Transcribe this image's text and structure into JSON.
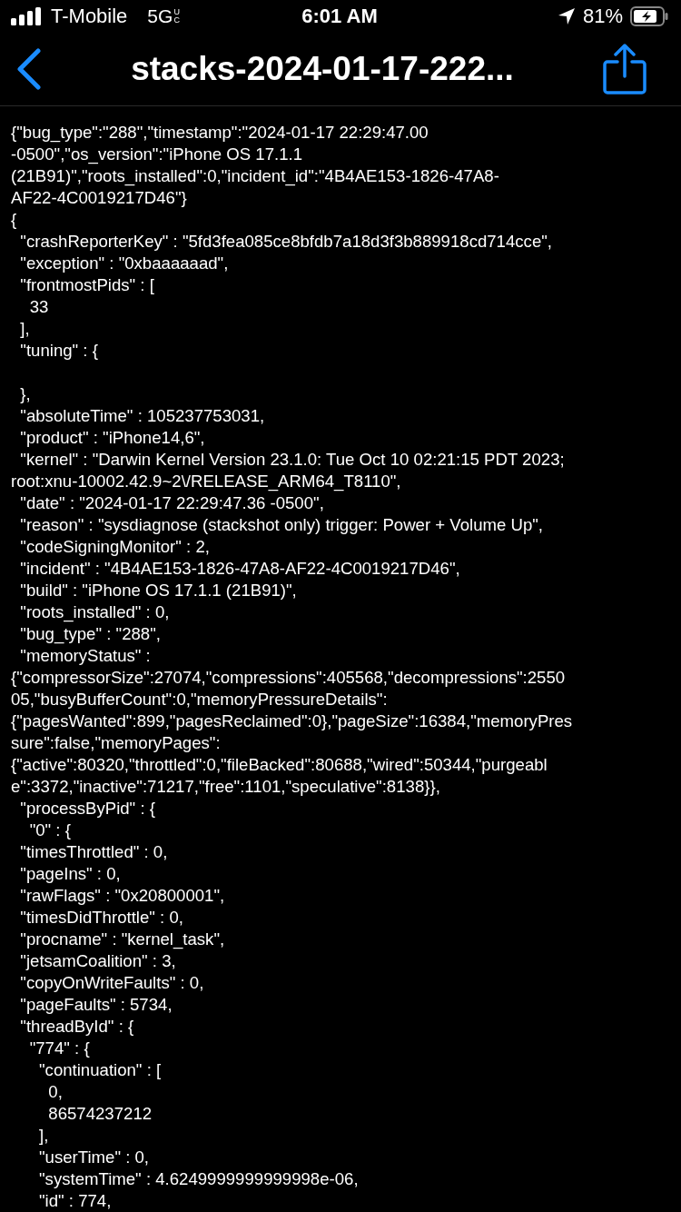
{
  "status_bar": {
    "carrier": "T-Mobile",
    "network": "5G",
    "network_suffix": "UC",
    "time": "6:01 AM",
    "battery": "81%"
  },
  "nav": {
    "title": "stacks-2024-01-17-222..."
  },
  "lines": [
    {
      "text": "{\"bug_type\":\"288\",\"timestamp\":\"2024-01-17 22:29:47.00"
    },
    {
      "text": "-0500\",\"os_version\":\"iPhone OS 17.1.1"
    },
    {
      "text": "(21B91)\",\"roots_installed\":0,\"incident_id\":\"4B4AE153-1826-47A8-"
    },
    {
      "text": "AF22-4C0019217D46\"}"
    },
    {
      "text": "{"
    },
    {
      "text": "  \"crashReporterKey\" : \"5fd3fea085ce8bfdb7a18d3f3b889918cd714cce\","
    },
    {
      "text": "  \"exception\" : \"0xbaaaaaad\","
    },
    {
      "text": "  \"frontmostPids\" : ["
    },
    {
      "text": "    33"
    },
    {
      "text": "  ],"
    },
    {
      "text": "  \"tuning\" : {"
    },
    {
      "text": "  },",
      "blank_before": true
    },
    {
      "text": "  \"absoluteTime\" : 105237753031,"
    },
    {
      "text": "  \"product\" : \"iPhone14,6\","
    },
    {
      "text": "  \"kernel\" : \"Darwin Kernel Version 23.1.0: Tue Oct 10 02:21:15 PDT 2023;"
    },
    {
      "text": "root:xnu-10002.42.9~2\\/RELEASE_ARM64_T8110\","
    },
    {
      "text": "  \"date\" : \"2024-01-17 22:29:47.36 -0500\","
    },
    {
      "text": "  \"reason\" : \"sysdiagnose (stackshot only) trigger: Power + Volume Up\","
    },
    {
      "text": "  \"codeSigningMonitor\" : 2,"
    },
    {
      "text": "  \"incident\" : \"4B4AE153-1826-47A8-AF22-4C0019217D46\","
    },
    {
      "text": "  \"build\" : \"iPhone OS 17.1.1 (21B91)\","
    },
    {
      "text": "  \"roots_installed\" : 0,"
    },
    {
      "text": "  \"bug_type\" : \"288\","
    },
    {
      "text": "  \"memoryStatus\" :"
    },
    {
      "text": "{\"compressorSize\":27074,\"compressions\":405568,\"decompressions\":2550"
    },
    {
      "text": "05,\"busyBufferCount\":0,\"memoryPressureDetails\":"
    },
    {
      "text": "{\"pagesWanted\":899,\"pagesReclaimed\":0},\"pageSize\":16384,\"memoryPres"
    },
    {
      "text": "sure\":false,\"memoryPages\":"
    },
    {
      "text": "{\"active\":80320,\"throttled\":0,\"fileBacked\":80688,\"wired\":50344,\"purgeabl"
    },
    {
      "text": "e\":3372,\"inactive\":71217,\"free\":1101,\"speculative\":8138}},"
    },
    {
      "text": "  \"processByPid\" : {"
    },
    {
      "text": "    \"0\" : {"
    },
    {
      "text": "  \"timesThrottled\" : 0,"
    },
    {
      "text": "  \"pageIns\" : 0,"
    },
    {
      "text": "  \"rawFlags\" : \"0x20800001\","
    },
    {
      "text": "  \"timesDidThrottle\" : 0,"
    },
    {
      "text": "  \"procname\" : \"kernel_task\","
    },
    {
      "text": "  \"jetsamCoalition\" : 3,"
    },
    {
      "text": "  \"copyOnWriteFaults\" : 0,"
    },
    {
      "text": "  \"pageFaults\" : 5734,"
    },
    {
      "text": "  \"threadById\" : {"
    },
    {
      "text": "    \"774\" : {"
    },
    {
      "text": "      \"continuation\" : ["
    },
    {
      "text": "        0,"
    },
    {
      "text": "        86574237212"
    },
    {
      "text": "      ],"
    },
    {
      "text": "      \"userTime\" : 0,"
    },
    {
      "text": "      \"systemTime\" : 4.6249999999999998e-06,"
    },
    {
      "text": "      \"id\" : 774,"
    }
  ]
}
